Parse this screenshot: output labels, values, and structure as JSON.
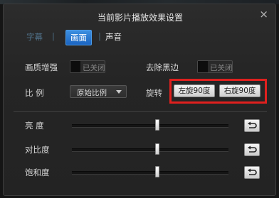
{
  "dialog": {
    "title": "当前影片播放效果设置",
    "close_icon": "×"
  },
  "tabs": [
    {
      "label": "字幕",
      "state": "dim"
    },
    {
      "label": "画面",
      "state": "active"
    },
    {
      "label": "声音",
      "state": "normal"
    }
  ],
  "tab_separator": "|",
  "options": {
    "quality_label": "画质增强",
    "quality_toggle": "已关闭",
    "blackedge_label": "去除黑边",
    "blackedge_toggle": "已关闭",
    "ratio_label": "比  例",
    "ratio_value": "原始比例",
    "rotate_label": "旋转",
    "rotate_left": "左旋90度",
    "rotate_right": "右旋90度"
  },
  "sliders": [
    {
      "label": "亮  度",
      "level": 0.5
    },
    {
      "label": "对比度",
      "level": 0.5
    },
    {
      "label": "饱和度",
      "level": 0.5
    }
  ],
  "colors": {
    "accent": "#1b65c1",
    "highlight_box": "#e0201e"
  },
  "icons": {
    "reset": "reset-arrow-icon",
    "close": "close-icon",
    "dropdown": "chevron-down-icon"
  }
}
